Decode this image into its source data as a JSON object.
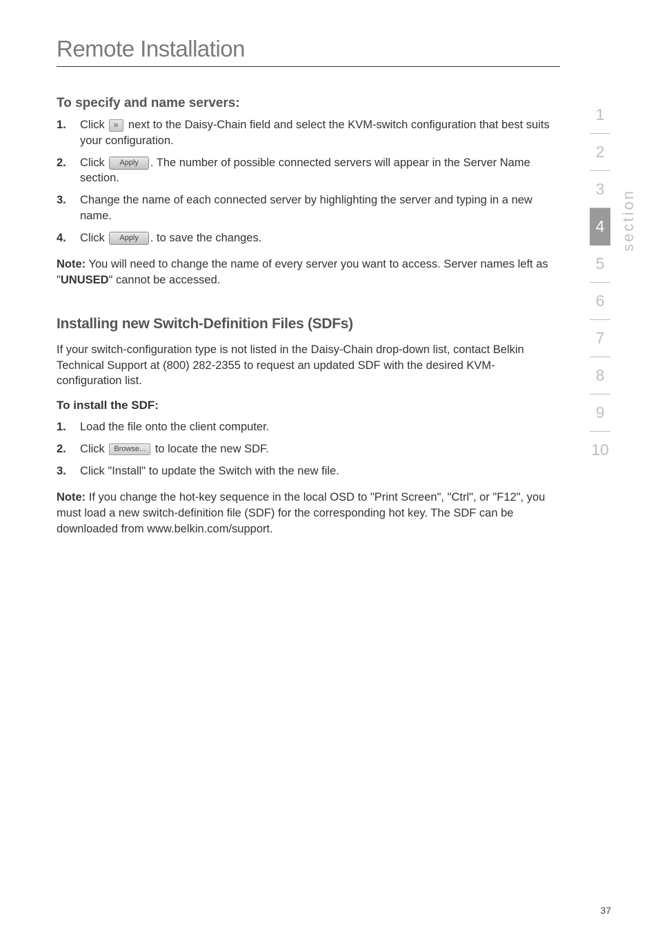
{
  "page": {
    "title": "Remote Installation",
    "number": "37"
  },
  "sidebar": {
    "label": "section",
    "tabs": [
      "1",
      "2",
      "3",
      "4",
      "5",
      "6",
      "7",
      "8",
      "9",
      "10"
    ],
    "active_index": 3
  },
  "buttons": {
    "apply_label": "Apply",
    "browse_label": "Browse..."
  },
  "block1": {
    "heading": "To specify and name servers:",
    "items": [
      {
        "num": "1.",
        "pre": "Click ",
        "icon": "chevron",
        "post": " next to the Daisy-Chain field and select the KVM-switch configuration that best suits your configuration."
      },
      {
        "num": "2.",
        "pre": "Click ",
        "icon": "apply",
        "post": ". The number of possible connected servers will appear in the Server Name section."
      },
      {
        "num": "3.",
        "text": "Change the name of each connected server by highlighting the server and typing in a new name."
      },
      {
        "num": "4.",
        "pre": "Click ",
        "icon": "apply",
        "post": ". to save the changes."
      }
    ],
    "note_bold": "Note:",
    "note_text": " You will need to change the name of every server you want to access. Server names left as \"",
    "note_strong": "UNUSED",
    "note_text2": "\" cannot be accessed."
  },
  "block2": {
    "heading": "Installing new Switch-Definition Files (SDFs)",
    "intro": "If your switch-configuration type is not listed in the Daisy-Chain drop-down list, contact Belkin Technical Support at (800) 282-2355 to request an updated SDF with the desired KVM-configuration list.",
    "subheading": "To install the SDF:",
    "items": [
      {
        "num": "1.",
        "text": "Load the file onto the client computer."
      },
      {
        "num": "2.",
        "pre": "Click ",
        "icon": "browse",
        "post": " to locate the new SDF."
      },
      {
        "num": "3.",
        "text": "Click \"Install\" to update the Switch with the new file."
      }
    ],
    "note_bold": "Note:",
    "note_text": " If you change the hot-key sequence in the local OSD to \"Print Screen\", \"Ctrl\", or \"F12\", you must load a new switch-definition file (SDF) for the corresponding hot key. The SDF can be downloaded from www.belkin.com/support."
  }
}
